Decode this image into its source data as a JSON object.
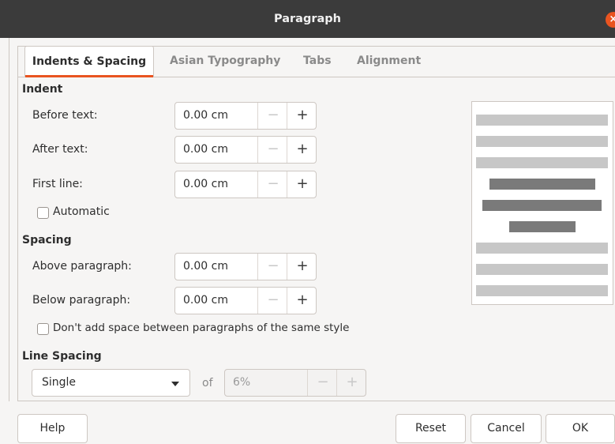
{
  "dialog": {
    "title": "Paragraph"
  },
  "tabs": [
    {
      "label": "Indents & Spacing"
    },
    {
      "label": "Asian Typography"
    },
    {
      "label": "Tabs"
    },
    {
      "label": "Alignment"
    }
  ],
  "indent": {
    "heading": "Indent",
    "before_text": {
      "label": "Before text:",
      "value": "0.00 cm"
    },
    "after_text": {
      "label": "After text:",
      "value": "0.00 cm"
    },
    "first_line": {
      "label": "First line:",
      "value": "0.00 cm"
    },
    "automatic": {
      "label": "Automatic",
      "checked": false
    }
  },
  "spacing": {
    "heading": "Spacing",
    "above": {
      "label": "Above paragraph:",
      "value": "0.00 cm"
    },
    "below": {
      "label": "Below paragraph:",
      "value": "0.00 cm"
    },
    "no_space_same_style": {
      "label": "Don't add space between paragraphs of the same style",
      "checked": false
    }
  },
  "line_spacing": {
    "heading": "Line Spacing",
    "selected": "Single",
    "of_label": "of",
    "value": "6%"
  },
  "spin_symbols": {
    "minus": "−",
    "plus": "+"
  },
  "close_symbol": "×",
  "buttons": {
    "help": "Help",
    "reset": "Reset",
    "cancel": "Cancel",
    "ok": "OK"
  },
  "colors": {
    "accent": "#e95420",
    "preview_light": "#c7c7c7",
    "preview_dark": "#7a7a7a"
  }
}
